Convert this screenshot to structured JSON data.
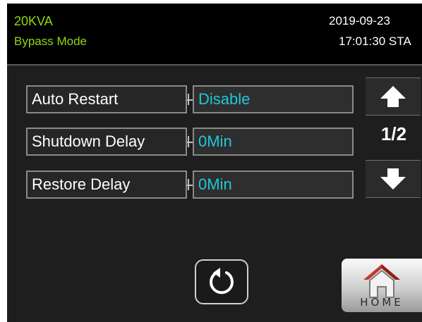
{
  "header": {
    "model": "20KVA",
    "mode": "Bypass Mode",
    "date": "2019-09-23",
    "time": "17:01:30 STA"
  },
  "settings": [
    {
      "label": "Auto Restart",
      "value": "Disable"
    },
    {
      "label": "Shutdown Delay",
      "value": "0Min"
    },
    {
      "label": "Restore Delay",
      "value": "0Min"
    }
  ],
  "pagination": {
    "indicator": "1/2",
    "up_icon": "arrow-up-icon",
    "down_icon": "arrow-down-icon"
  },
  "footer": {
    "back_icon": "refresh-icon",
    "home_icon": "house-icon",
    "home_label": "HOME"
  },
  "colors": {
    "status_green": "#8fd80f",
    "value_cyan": "#1ec8d8",
    "home_roof_red": "#c0392b"
  }
}
